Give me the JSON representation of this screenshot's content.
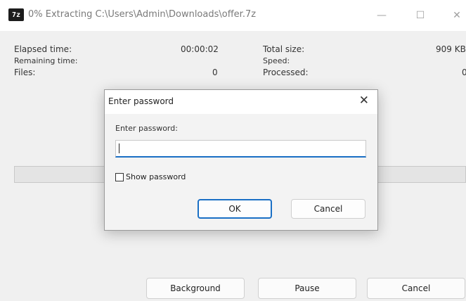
{
  "window": {
    "icon_text": "7z",
    "title": "0% Extracting C:\\Users\\Admin\\Downloads\\offer.7z",
    "minimize_glyph": "—",
    "maximize_glyph": "☐",
    "close_glyph": "✕"
  },
  "stats": {
    "elapsed_label": "Elapsed time:",
    "elapsed_value": "00:00:02",
    "remaining_label": "Remaining time:",
    "files_label": "Files:",
    "files_value": "0",
    "total_size_label": "Total size:",
    "total_size_value": "909 KB",
    "speed_label": "Speed:",
    "processed_label": "Processed:",
    "processed_value": "0"
  },
  "buttons": {
    "background": "Background",
    "pause": "Pause",
    "cancel": "Cancel"
  },
  "password_dialog": {
    "title": "Enter password",
    "close_glyph": "✕",
    "prompt": "Enter password:",
    "input_value": "",
    "show_password_label": "Show password",
    "show_password_checked": false,
    "ok": "OK",
    "cancel": "Cancel"
  }
}
